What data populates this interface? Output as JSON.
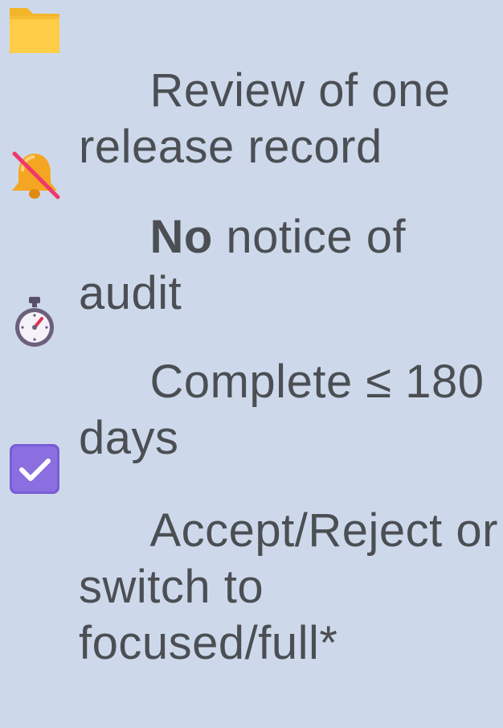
{
  "items": [
    {
      "icon": "folder-icon",
      "text": "Review of one release record"
    },
    {
      "icon": "bell-slash-icon",
      "bold": "No",
      "text": " notice of audit"
    },
    {
      "icon": "stopwatch-icon",
      "text": "Complete ≤ 180 days"
    },
    {
      "icon": "checkbox-checked-icon",
      "text": "Accept/Reject or switch to focused/full*"
    }
  ]
}
